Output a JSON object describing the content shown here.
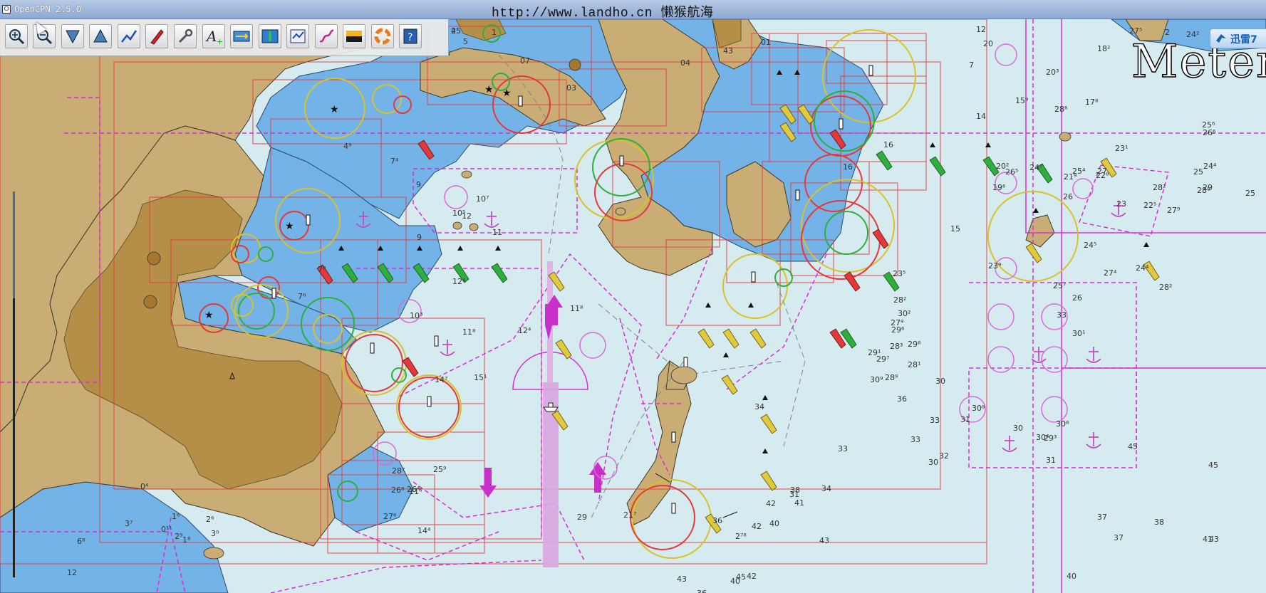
{
  "window": {
    "title": "OpenCPN 2.5.0",
    "banner": "http://www.landho.cn 懒猴航海"
  },
  "toolbar": {
    "tools": [
      {
        "name": "zoom-in-button",
        "icon": "zoom-in-icon"
      },
      {
        "name": "zoom-out-button",
        "icon": "zoom-out-icon"
      },
      {
        "name": "scale-in-button",
        "icon": "chart-scale-in-icon"
      },
      {
        "name": "scale-out-button",
        "icon": "chart-scale-out-icon"
      },
      {
        "name": "route-button",
        "icon": "route-icon"
      },
      {
        "name": "auto-follow-button",
        "icon": "ship-icon"
      },
      {
        "name": "settings-button",
        "icon": "wrench-icon"
      },
      {
        "name": "text-toggle-button",
        "icon": "text-a-icon"
      },
      {
        "name": "current-button",
        "icon": "current-icon"
      },
      {
        "name": "tide-button",
        "icon": "tide-icon"
      },
      {
        "name": "route-manager-button",
        "icon": "route-manager-icon"
      },
      {
        "name": "track-button",
        "icon": "track-icon"
      },
      {
        "name": "color-scheme-button",
        "icon": "color-scheme-icon"
      },
      {
        "name": "mob-button",
        "icon": "lifebuoy-icon"
      },
      {
        "name": "help-button",
        "icon": "help-icon"
      }
    ]
  },
  "overlay": {
    "meter_text": "Meter",
    "xunlei_label": "迅雷7"
  },
  "colors": {
    "land": "#c9ad74",
    "land_dark": "#b58f47",
    "shallow": "#73b3e8",
    "deep": "#d6ebf0",
    "magenta": "#d42fd4",
    "red": "#e5383b",
    "yellow": "#d8c22a",
    "green": "#2eaf3d"
  },
  "soundings": [
    "2",
    "1",
    "6",
    "5",
    "07",
    "03",
    "43",
    "04",
    "01",
    "12",
    "7",
    "14",
    "18²",
    "2",
    "27⁵",
    "28⁸",
    "20³",
    "15⁹",
    "17⁸",
    "24²",
    "16",
    "4⁹",
    "7⁴",
    "9",
    "12",
    "9",
    "10⁵",
    "10⁷",
    "11",
    "12⁴",
    "11⁸",
    "12⁴",
    "11⁸",
    "15¹",
    "14⁷",
    "10³",
    "7⁸",
    "7⁶",
    "16",
    "23¹",
    "21⁹",
    "19⁶",
    "20²",
    "15",
    "23⁹",
    "26⁵",
    "25",
    "24⁷",
    "25⁴",
    "26",
    "27",
    "28⁸",
    "28²",
    "27⁹",
    "29",
    "20",
    "22⁵",
    "22⁸",
    "23",
    "24⁴",
    "25⁶",
    "26⁶",
    "25",
    "23⁵",
    "24⁵",
    "24⁴",
    "25⁷",
    "26",
    "27⁴",
    "28²",
    "30¹",
    "33",
    "28²",
    "30²",
    "29⁶",
    "28³",
    "27⁹",
    "28¹",
    "30",
    "33",
    "29⁸",
    "29⁷",
    "28⁹",
    "29¹",
    "30⁹",
    "34",
    "33",
    "36",
    "38",
    "34",
    "33",
    "30",
    "32",
    "31",
    "30⁴",
    "30⁸",
    "29³",
    "30⁸",
    "31",
    "30",
    "45",
    "45",
    "43",
    "40",
    "37",
    "38",
    "37",
    "41",
    "41",
    "42",
    "43",
    "40",
    "36",
    "31",
    "29",
    "21⁷",
    "27⁶",
    "26⁸",
    "26⁴",
    "28⁷",
    "25⁹",
    "14⁴",
    "11⁶",
    "12",
    "6⁸",
    "3⁷",
    "0⁴",
    "0¹¹",
    "2⁹",
    "3⁰",
    "2⁶",
    "1⁶",
    "1⁸",
    "2⁷⁸",
    "45",
    "42",
    "43",
    "36",
    "40",
    "42",
    "45"
  ],
  "place_labels": [
    "1⁶",
    "4⁹",
    "7⁴",
    "10⁵",
    "10⁷",
    "11",
    "12⁴",
    "11⁸"
  ]
}
